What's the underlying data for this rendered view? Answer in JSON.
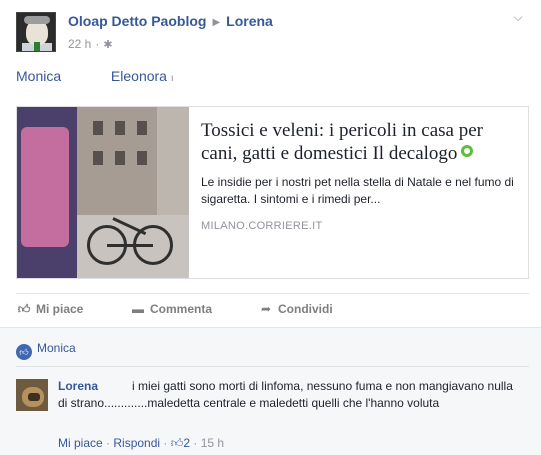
{
  "post": {
    "author": "Oloap Detto Paoblog",
    "target": "Lorena",
    "time": "22 h",
    "separator": "·"
  },
  "tags": [
    "Monica",
    "Eleonora"
  ],
  "link_card": {
    "title": "Tossici e veleni: i pericoli in casa per cani, gatti e domestici Il decalogo",
    "description": "Le insidie per i nostri pet nella stella di Natale e nel fumo di sigaretta. I sintomi e i rimedi per...",
    "source": "MILANO.CORRIERE.IT"
  },
  "actions": {
    "like": "Mi piace",
    "comment": "Commenta",
    "share": "Condividi"
  },
  "likes": {
    "name": "Monica"
  },
  "comment": {
    "author": "Lorena",
    "text": "i miei gatti sono morti di linfoma, nessuno fuma e non mangiavano nulla di strano.............maledetta centrale e maledetti quelli che l'hanno voluta",
    "like_label": "Mi piace",
    "reply_label": "Rispondi",
    "like_count": "2",
    "time": "15 h",
    "separator": "·"
  },
  "colors": {
    "link_blue": "#365899",
    "muted_gray": "#90949c",
    "like_badge": "#4267b2",
    "external_dot": "#5cbf3b"
  },
  "icons": {
    "privacy": "gear-icon",
    "menu": "chevron-down-icon",
    "like": "thumbs-up-icon",
    "comment": "comment-icon",
    "share": "share-arrow-icon"
  }
}
